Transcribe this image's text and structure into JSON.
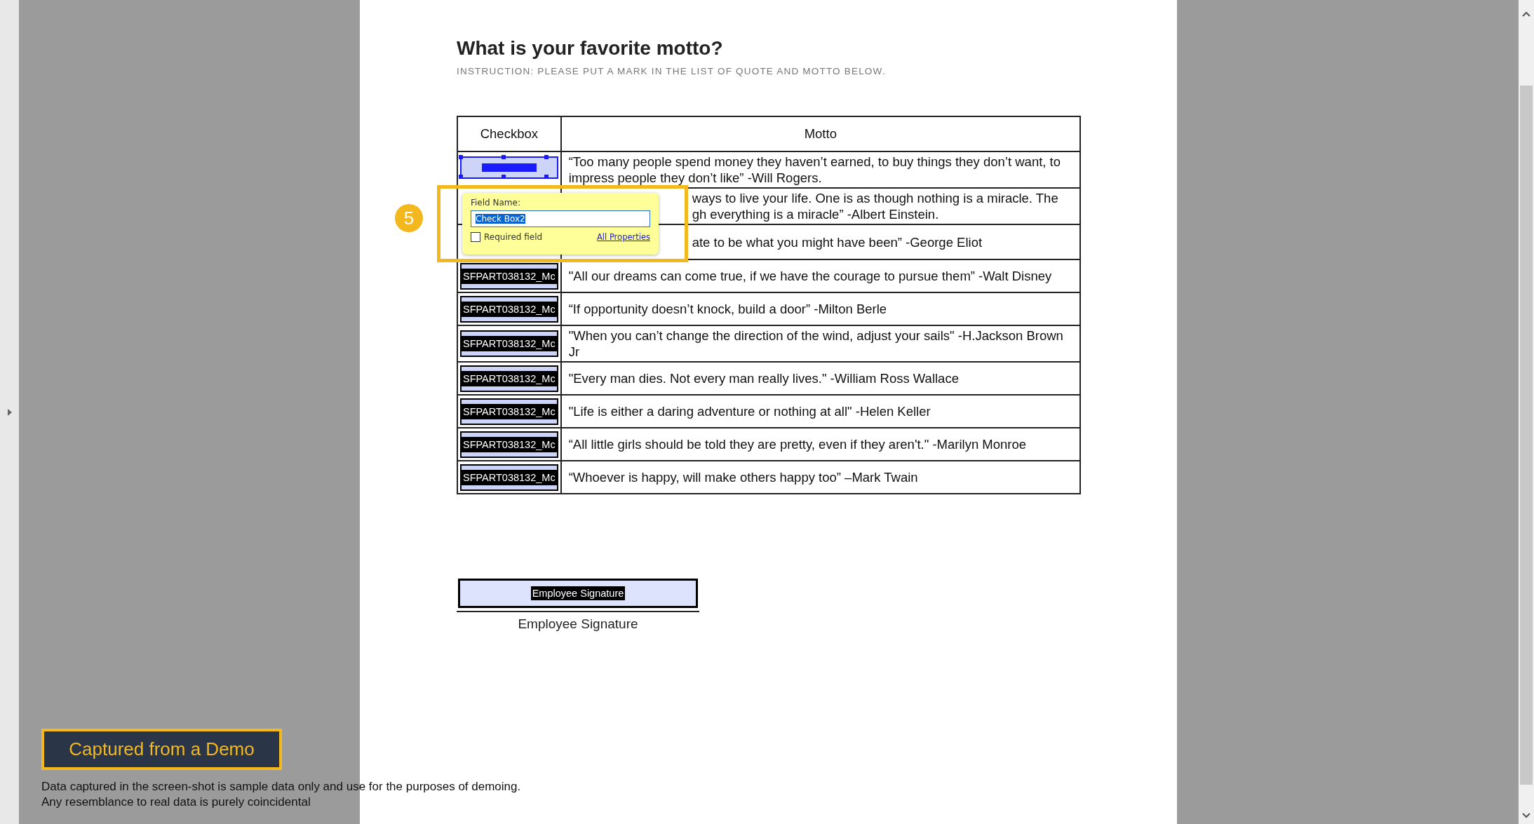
{
  "document": {
    "title": "What is your favorite motto?",
    "instruction": "INSTRUCTION: PLEASE PUT A MARK IN THE LIST OF QUOTE AND MOTTO BELOW."
  },
  "table": {
    "columns": [
      "Checkbox",
      "Motto"
    ],
    "rows": [
      {
        "selected": true,
        "motto": "“Too many people spend money they haven’t earned, to buy things they don’t want, to impress people they don’t like” -Will Rogers."
      },
      {
        "selected": false,
        "motto": "ways to live your life. One is as though nothing is a miracle. The gh everything is a miracle” -Albert Einstein."
      },
      {
        "selected": false,
        "motto": "ate to be what you might have been” -George Eliot"
      },
      {
        "selected": false,
        "field_label": "SFPART038132_Mc",
        "motto": "\"All our dreams can come true, if we have the courage to pursue them” -Walt Disney"
      },
      {
        "selected": false,
        "field_label": "SFPART038132_Mc",
        "motto": "“If opportunity doesn’t knock, build a door” -Milton Berle"
      },
      {
        "selected": false,
        "field_label": "SFPART038132_Mc",
        "motto": "\"When you can’t change the direction of the wind, adjust your sails\" -H.Jackson Brown Jr"
      },
      {
        "selected": false,
        "field_label": "SFPART038132_Mc",
        "motto": "\"Every man dies. Not every man really lives.\" -William Ross Wallace"
      },
      {
        "selected": false,
        "field_label": "SFPART038132_Mc",
        "motto": "\"Life is either a daring adventure or nothing at all\" -Helen Keller"
      },
      {
        "selected": false,
        "field_label": "SFPART038132_Mc",
        "motto": "“All little girls should be told they are pretty, even if they aren't.\" -Marilyn Monroe"
      },
      {
        "selected": false,
        "field_label": "SFPART038132_Mc",
        "motto": "“Whoever is happy, will make others happy too” –Mark Twain"
      }
    ]
  },
  "popup": {
    "step": "5",
    "label": "Field Name:",
    "value": "Check Box2",
    "required": {
      "label": "Required field",
      "checked": false
    },
    "link": "All Properties"
  },
  "signature": {
    "field_label": "Employee Signature",
    "caption": "Employee Signature"
  },
  "banner": {
    "title": "Captured from a Demo",
    "disclaimer": [
      "Data captured in the screen-shot is sample data only and use for the purposes of demoing.",
      "Any resemblance to real data is purely coincidental"
    ]
  }
}
